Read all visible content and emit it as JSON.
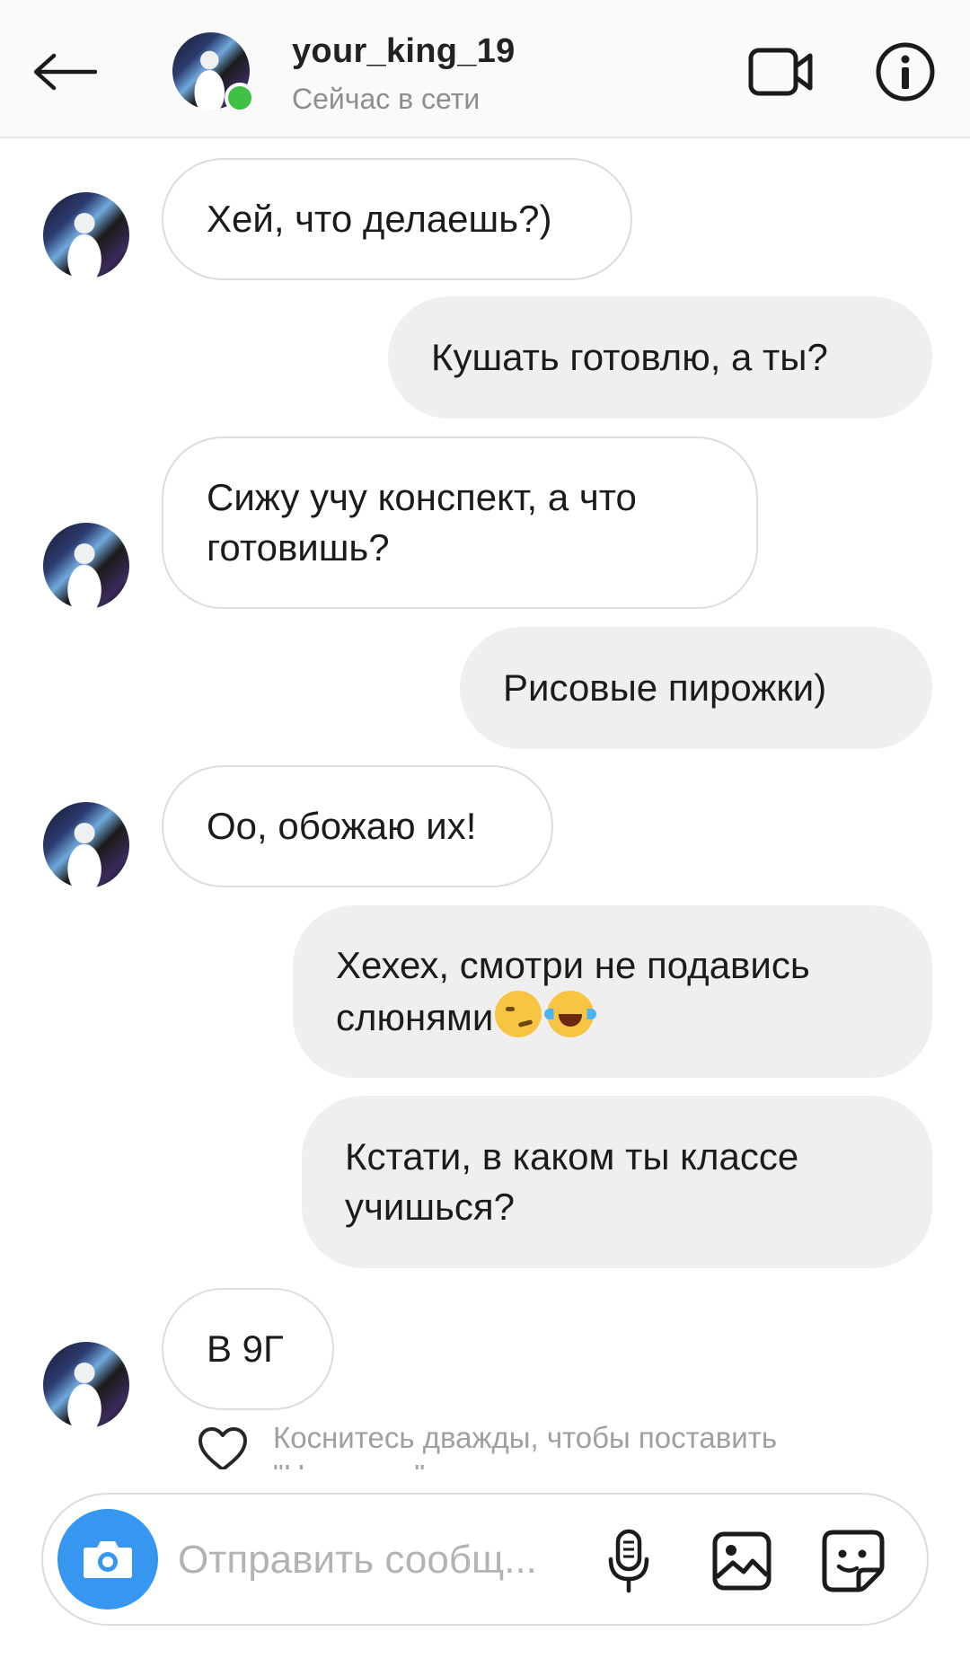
{
  "header": {
    "username": "your_king_19",
    "status": "Сейчас в сети",
    "online_color": "#3ec145",
    "icons": [
      "back-arrow-icon",
      "video-camera-icon",
      "info-icon"
    ]
  },
  "messages": [
    {
      "from": "them",
      "text": "Хей, что делаешь?)"
    },
    {
      "from": "me",
      "text": "Кушать готовлю, а ты?"
    },
    {
      "from": "them",
      "lines": [
        "Сижу учу конспект, а что",
        "готовишь?"
      ]
    },
    {
      "from": "me",
      "text": "Рисовые пирожки)"
    },
    {
      "from": "them",
      "text": "Оо, обожаю их!"
    },
    {
      "from": "me",
      "lines": [
        "Хехех, смотри не подавись",
        "слюнями"
      ],
      "emojis": [
        "smirking-face",
        "tears-of-joy"
      ]
    },
    {
      "from": "me",
      "lines": [
        "Кстати, в каком ты классе",
        "учишься?"
      ]
    },
    {
      "from": "them",
      "text": "В 9Г"
    }
  ],
  "like_hint": {
    "line1": "Коснитесь дважды, чтобы поставить",
    "line2": "\"Нравится\""
  },
  "composer": {
    "placeholder": "Отправить сообщ...",
    "accent": "#3797f0",
    "icons": [
      "camera-icon",
      "microphone-icon",
      "gallery-icon",
      "sticker-icon"
    ]
  }
}
